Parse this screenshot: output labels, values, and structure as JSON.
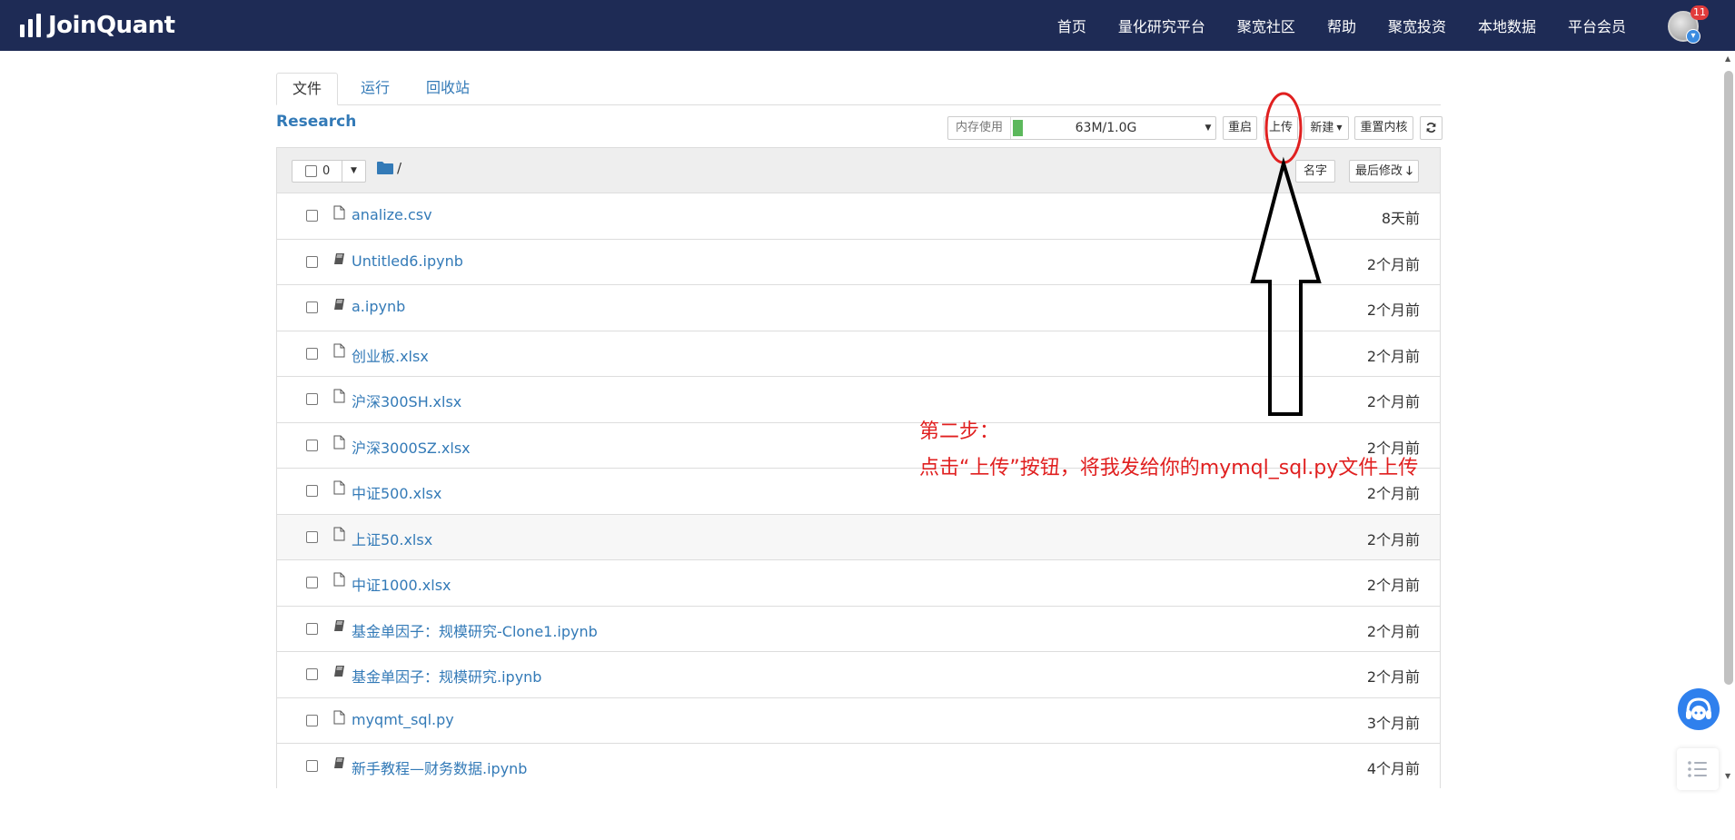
{
  "header": {
    "logo_text": "JoinQuant",
    "nav": [
      "首页",
      "量化研究平台",
      "聚宽社区",
      "帮助",
      "聚宽投资",
      "本地数据",
      "平台会员"
    ],
    "notification_count": "11"
  },
  "tabs": [
    "文件",
    "运行",
    "回收站"
  ],
  "section_title": "Research",
  "toolbar": {
    "memory_label": "内存使用",
    "memory_value": "63M/1.0G",
    "memory_fraction": 0.063,
    "restart": "重启",
    "upload": "上传",
    "new": "新建",
    "reset_kernel": "重置内核"
  },
  "list_header": {
    "selected_count": "0",
    "path": "/",
    "sort_name": "名字",
    "sort_modified": "最后修改"
  },
  "files": [
    {
      "name": "analize.csv",
      "date": "8天前",
      "type": "file"
    },
    {
      "name": "Untitled6.ipynb",
      "date": "2个月前",
      "type": "notebook"
    },
    {
      "name": "a.ipynb",
      "date": "2个月前",
      "type": "notebook"
    },
    {
      "name": "创业板.xlsx",
      "date": "2个月前",
      "type": "file"
    },
    {
      "name": "沪深300SH.xlsx",
      "date": "2个月前",
      "type": "file"
    },
    {
      "name": "沪深3000SZ.xlsx",
      "date": "2个月前",
      "type": "file"
    },
    {
      "name": "中证500.xlsx",
      "date": "2个月前",
      "type": "file"
    },
    {
      "name": "上证50.xlsx",
      "date": "2个月前",
      "type": "file"
    },
    {
      "name": "中证1000.xlsx",
      "date": "2个月前",
      "type": "file"
    },
    {
      "name": "基金单因子：规模研究-Clone1.ipynb",
      "date": "2个月前",
      "type": "notebook"
    },
    {
      "name": "基金单因子：规模研究.ipynb",
      "date": "2个月前",
      "type": "notebook"
    },
    {
      "name": "myqmt_sql.py",
      "date": "3个月前",
      "type": "file"
    },
    {
      "name": "新手教程—财务数据.ipynb",
      "date": "4个月前",
      "type": "notebook"
    }
  ],
  "annotation": {
    "line1": "第二步：",
    "line2": "点击“上传”按钮，将我发给你的mymql_sql.py文件上传",
    "color": "#e02020"
  },
  "colors": {
    "navbar": "#1e2b55",
    "link": "#337ab7",
    "memory_bar": "#5cb85c"
  }
}
